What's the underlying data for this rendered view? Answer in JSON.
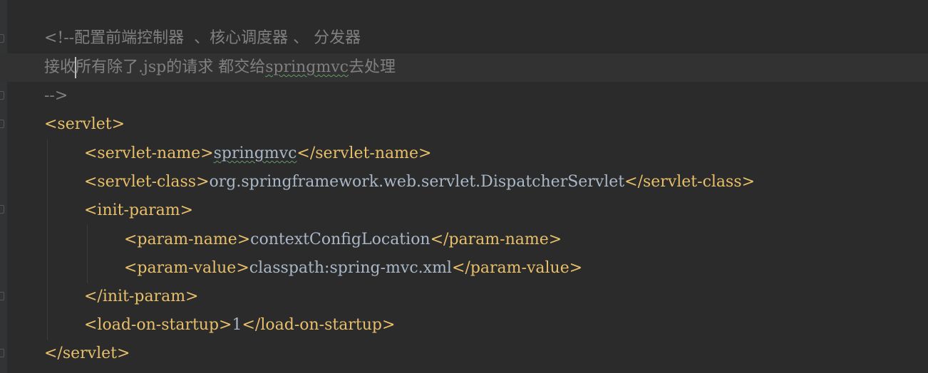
{
  "editor": {
    "lines": [
      {
        "segments": [
          {
            "text": "<!--配置前端控制器  、核心调度器 、 分发器",
            "kind": "comment"
          }
        ]
      },
      {
        "segments": [
          {
            "text": "接收",
            "kind": "comment"
          },
          {
            "text": "",
            "kind": "caret"
          },
          {
            "text": "所有除了.jsp的请求 都交给",
            "kind": "comment"
          },
          {
            "text": "springmvc",
            "kind": "comment-typo"
          },
          {
            "text": "去处理",
            "kind": "comment"
          }
        ]
      },
      {
        "segments": [
          {
            "text": "-->",
            "kind": "comment"
          }
        ]
      },
      {
        "segments": [
          {
            "text": "<servlet>",
            "kind": "tag"
          }
        ]
      },
      {
        "segments": [
          {
            "text": "<servlet-name>",
            "kind": "tag"
          },
          {
            "text": "springmvc",
            "kind": "text-typo"
          },
          {
            "text": "</servlet-name>",
            "kind": "tag"
          }
        ]
      },
      {
        "segments": [
          {
            "text": "<servlet-class>",
            "kind": "tag"
          },
          {
            "text": "org.springframework.web.servlet.DispatcherServlet",
            "kind": "text"
          },
          {
            "text": "</servlet-class>",
            "kind": "tag"
          }
        ]
      },
      {
        "segments": [
          {
            "text": "<init-param>",
            "kind": "tag"
          }
        ]
      },
      {
        "segments": [
          {
            "text": "<param-name>",
            "kind": "tag"
          },
          {
            "text": "contextConfigLocation",
            "kind": "text"
          },
          {
            "text": "</param-name>",
            "kind": "tag"
          }
        ]
      },
      {
        "segments": [
          {
            "text": "<param-value>",
            "kind": "tag"
          },
          {
            "text": "classpath:spring-mvc.xml",
            "kind": "text"
          },
          {
            "text": "</param-value>",
            "kind": "tag"
          }
        ]
      },
      {
        "segments": [
          {
            "text": "</init-param>",
            "kind": "tag"
          }
        ]
      },
      {
        "segments": [
          {
            "text": "<load-on-startup>",
            "kind": "tag"
          },
          {
            "text": "1",
            "kind": "text"
          },
          {
            "text": "</load-on-startup>",
            "kind": "tag"
          }
        ]
      },
      {
        "segments": [
          {
            "text": "</servlet>",
            "kind": "tag"
          }
        ]
      }
    ]
  },
  "colors": {
    "background": "#2b2b2b",
    "current_line": "#323232",
    "comment": "#808080",
    "tag": "#e8bf6a",
    "text": "#a9b7c6",
    "typo_underline": "#659c6b"
  }
}
